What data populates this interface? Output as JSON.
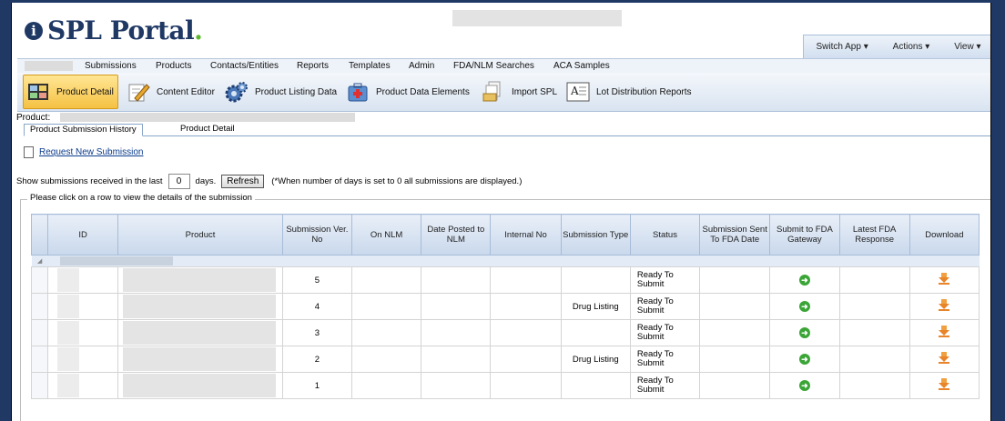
{
  "app": {
    "logo_icon": "i",
    "title": "SPL Portal",
    "title_dot": "."
  },
  "top_menu": {
    "switch_app": "Switch App",
    "actions": "Actions",
    "view": "View"
  },
  "menubar": [
    "Submissions",
    "Products",
    "Contacts/Entities",
    "Reports",
    "Templates",
    "Admin",
    "FDA/NLM Searches",
    "ACA Samples"
  ],
  "toolbar": [
    {
      "label": "Product Detail",
      "icon": "product-detail-icon"
    },
    {
      "label": "Content Editor",
      "icon": "pencil-icon"
    },
    {
      "label": "Product Listing Data",
      "icon": "gears-icon"
    },
    {
      "label": "Product Data Elements",
      "icon": "medical-kit-icon"
    },
    {
      "label": "Import SPL",
      "icon": "import-icon"
    },
    {
      "label": "Lot Distribution Reports",
      "icon": "report-icon"
    }
  ],
  "product_label": "Product:",
  "tabs": [
    "Product Submission History",
    "Product Detail"
  ],
  "request_link": "Request New Submission",
  "filter": {
    "prefix": "Show submissions received in the last",
    "days_value": "0",
    "suffix": "days.",
    "refresh": "Refresh",
    "note": "(*When number of days is set to 0 all submissions are displayed.)"
  },
  "legend": "Please click on a row to view the details of the submission",
  "grid": {
    "headers": [
      "ID",
      "Product",
      "Submission Ver. No",
      "On NLM",
      "Date Posted to NLM",
      "Internal No",
      "Submission Type",
      "Status",
      "Submission Sent To FDA Date",
      "Submit to FDA Gateway",
      "Latest FDA Response",
      "Download"
    ],
    "rows": [
      {
        "ver": "5",
        "type": "",
        "status": "Ready To Submit"
      },
      {
        "ver": "4",
        "type": "Drug Listing",
        "status": "Ready To Submit"
      },
      {
        "ver": "3",
        "type": "",
        "status": "Ready To Submit"
      },
      {
        "ver": "2",
        "type": "Drug Listing",
        "status": "Ready To Submit"
      },
      {
        "ver": "1",
        "type": "",
        "status": "Ready To Submit"
      }
    ]
  },
  "colors": {
    "brand": "#1f3864",
    "accent": "#5cb82b",
    "link": "#0b3c8c"
  }
}
